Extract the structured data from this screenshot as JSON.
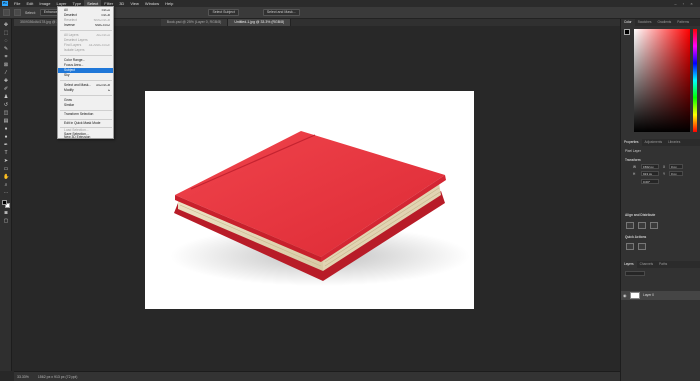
{
  "menubar": {
    "logo": "Ps",
    "menus": [
      "File",
      "Edit",
      "Image",
      "Layer",
      "Type",
      "Select",
      "Filter",
      "3D",
      "View",
      "Window",
      "Help"
    ],
    "active_menu": "Select"
  },
  "options": {
    "select_label": "Select:",
    "select_value": "Enhanced",
    "select_subject": "Select Subject",
    "select_mask": "Select and Mask..."
  },
  "tabs": [
    {
      "label": "3509356d4d178.jpg @ 33.3% (Layer 0, RGB/8)"
    },
    {
      "label": "Book.psd @ 25% (Layer 0, RGB/8)"
    },
    {
      "label": "Untitled-1.jpg @ 33.3% (RGB/8)"
    }
  ],
  "dropdown": {
    "items": [
      {
        "label": "All",
        "shortcut": "Ctrl+A",
        "disabled": false
      },
      {
        "label": "Deselect",
        "shortcut": "Ctrl+D",
        "disabled": false
      },
      {
        "label": "Reselect",
        "shortcut": "Shift+Ctrl+D",
        "disabled": true
      },
      {
        "label": "Inverse",
        "shortcut": "Shift+Ctrl+I",
        "disabled": false
      },
      {
        "label": "All Layers",
        "shortcut": "Alt+Ctrl+A",
        "disabled": true
      },
      {
        "label": "Deselect Layers",
        "shortcut": "",
        "disabled": true
      },
      {
        "label": "Find Layers",
        "shortcut": "Alt+Shift+Ctrl+F",
        "disabled": true
      },
      {
        "label": "Isolate Layers",
        "shortcut": "",
        "disabled": true
      },
      {
        "label": "Color Range...",
        "shortcut": "",
        "disabled": false
      },
      {
        "label": "Focus Area...",
        "shortcut": "",
        "disabled": false
      },
      {
        "label": "Subject",
        "shortcut": "",
        "disabled": false,
        "highlighted": true
      },
      {
        "label": "Sky",
        "shortcut": "",
        "disabled": false
      },
      {
        "label": "Select and Mask...",
        "shortcut": "Alt+Ctrl+R",
        "disabled": false
      },
      {
        "label": "Modify",
        "shortcut": "▸",
        "disabled": false
      },
      {
        "label": "Grow",
        "shortcut": "",
        "disabled": false
      },
      {
        "label": "Similar",
        "shortcut": "",
        "disabled": false
      },
      {
        "label": "Transform Selection",
        "shortcut": "",
        "disabled": false
      },
      {
        "label": "Edit in Quick Mask Mode",
        "shortcut": "",
        "disabled": false
      },
      {
        "label": "Load Selection...",
        "shortcut": "",
        "disabled": true
      },
      {
        "label": "Save Selection...",
        "shortcut": "",
        "disabled": false
      },
      {
        "label": "New 3D Extrusion",
        "shortcut": "",
        "disabled": false
      }
    ]
  },
  "right_panels": {
    "color_tabs": [
      "Color",
      "Swatches",
      "Gradients",
      "Patterns"
    ],
    "properties_tabs": [
      "Properties",
      "Adjustments",
      "Libraries"
    ],
    "properties_type": "Pixel Layer",
    "transform_title": "Transform",
    "transform": {
      "w": "1562 px",
      "h": "913 px",
      "x": "0 px",
      "y": "0 px"
    },
    "rotation": "0.00°",
    "align_title": "Align and Distribute",
    "quick_actions": "Quick Actions",
    "layers_tabs": [
      "Layers",
      "Channels",
      "Paths"
    ],
    "layer_name": "Layer 0"
  },
  "status": {
    "zoom": "33.33%",
    "doc_info": "1562 px x 913 px (72 ppi)"
  },
  "colors": {
    "book_cover": "#e8303a",
    "book_spine": "#c8202c",
    "pages": "#e8dcc0",
    "accent": "#1f77d8"
  }
}
